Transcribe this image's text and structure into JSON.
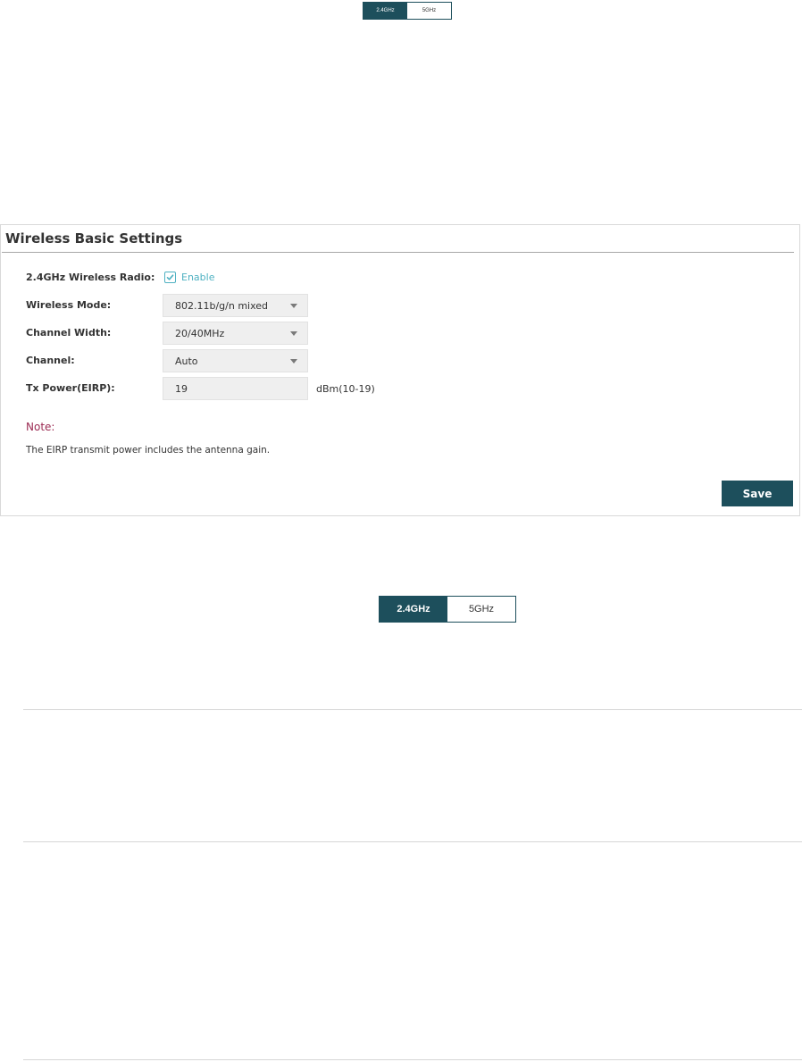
{
  "band_toggle_small": {
    "band_24": "2.4GHz",
    "band_5": "5GHz",
    "active": "2.4GHz"
  },
  "panel": {
    "title": "Wireless Basic Settings",
    "radio": {
      "label": "2.4GHz Wireless Radio:",
      "checked": true,
      "enable_label": "Enable"
    },
    "wireless_mode": {
      "label": "Wireless Mode:",
      "value": "802.11b/g/n mixed"
    },
    "channel_width": {
      "label": "Channel Width:",
      "value": "20/40MHz"
    },
    "channel": {
      "label": "Channel:",
      "value": "Auto"
    },
    "tx_power": {
      "label": "Tx Power(EIRP):",
      "value": "19",
      "unit": "dBm(10-19)"
    },
    "note": {
      "title": "Note:",
      "text": "The EIRP transmit power includes the antenna gain."
    },
    "save_label": "Save"
  },
  "band_toggle_large": {
    "band_24": "2.4GHz",
    "band_5": "5GHz",
    "active": "2.4GHz"
  },
  "colors": {
    "accent": "#1d4f5c",
    "enable_text": "#4fb1c2",
    "note_title": "#9b2a52",
    "field_bg": "#efefef"
  },
  "icons": {
    "checkbox": "check-icon",
    "dropdown": "caret-down-icon"
  }
}
